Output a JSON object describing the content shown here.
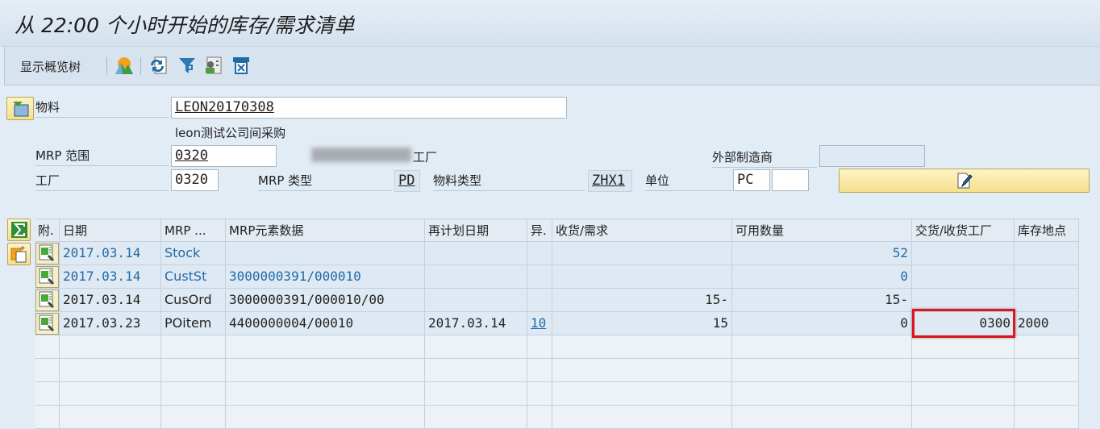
{
  "title": "从 22:00 个小时开始的库存/需求清单",
  "toolbar": {
    "overview_tree": "显示概览树",
    "icons": [
      "picture-icon",
      "refresh-icon",
      "filter-icon",
      "user-details-icon",
      "delete-icon"
    ]
  },
  "header": {
    "material_label": "物料",
    "material_value": "LEON20170308",
    "material_desc": "leon测试公司间采购",
    "mrp_area_label": "MRP 范围",
    "mrp_area_value": "0320",
    "plant_name_suffix": "工厂",
    "ext_mfr_label": "外部制造商",
    "ext_mfr_value": "",
    "plant_label": "工厂",
    "plant_value": "0320",
    "mrp_type_label": "MRP 类型",
    "mrp_type_value": "PD",
    "mat_type_label": "物料类型",
    "mat_type_value": "ZHX1",
    "unit_label": "单位",
    "unit_value": "PC",
    "unit_extra": ""
  },
  "table": {
    "columns": [
      "附.",
      "日期",
      "MRP ...",
      "MRP元素数据",
      "再计划日期",
      "异.",
      "收货/需求",
      "可用数量",
      "交货/收货工厂",
      "库存地点"
    ],
    "rows": [
      {
        "date": "2017.03.14",
        "mrp": "Stock",
        "data": "",
        "reschedule": "",
        "exc": "",
        "rec_req": "",
        "avail": "52",
        "plant": "",
        "sloc": "",
        "blue": true
      },
      {
        "date": "2017.03.14",
        "mrp": "CustSt",
        "data": "3000000391/000010",
        "reschedule": "",
        "exc": "",
        "rec_req": "",
        "avail": "0",
        "plant": "",
        "sloc": "",
        "blue": true
      },
      {
        "date": "2017.03.14",
        "mrp": "CusOrd",
        "data": "3000000391/000010/00",
        "reschedule": "",
        "exc": "",
        "rec_req": "15-",
        "avail": "15-",
        "plant": "",
        "sloc": "",
        "blue": false
      },
      {
        "date": "2017.03.23",
        "mrp": "POitem",
        "data": "4400000004/00010",
        "reschedule": "2017.03.14",
        "exc": "10",
        "rec_req": "15",
        "avail": "0",
        "plant": "0300",
        "sloc": "2000",
        "blue": false
      }
    ]
  },
  "colors": {
    "highlight": "#e0141e",
    "link": "#1f6aa5"
  }
}
